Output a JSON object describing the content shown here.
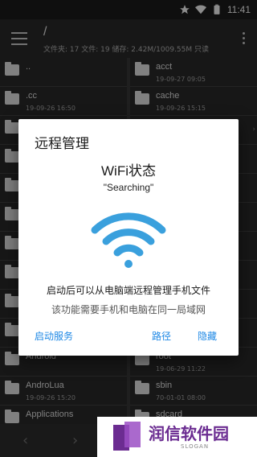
{
  "status_bar": {
    "time": "11:41",
    "icons": [
      "star-icon",
      "wifi-icon",
      "battery-icon"
    ]
  },
  "toolbar": {
    "path": "/",
    "stats": "文件夹: 17  文件: 19  储存: 2.42M/1009.55M  只读"
  },
  "files_left": [
    {
      "name": "..",
      "date": ""
    },
    {
      "name": ".cc",
      "date": "19-09-26 16:50"
    },
    {
      "name": "",
      "date": ""
    },
    {
      "name": "",
      "date": ""
    },
    {
      "name": "",
      "date": ""
    },
    {
      "name": "",
      "date": ""
    },
    {
      "name": "",
      "date": ""
    },
    {
      "name": "",
      "date": ""
    },
    {
      "name": "",
      "date": ""
    },
    {
      "name": "",
      "date": ""
    },
    {
      "name": "Android",
      "date": ""
    },
    {
      "name": "AndroLua",
      "date": "19-09-26 15:20"
    },
    {
      "name": "Applications",
      "date": ""
    }
  ],
  "files_right": [
    {
      "name": "acct",
      "date": "19-09-27 09:05"
    },
    {
      "name": "cache",
      "date": "19-09-26 15:15"
    },
    {
      "name": "",
      "date": ""
    },
    {
      "name": "",
      "date": ""
    },
    {
      "name": "",
      "date": ""
    },
    {
      "name": "",
      "date": ""
    },
    {
      "name": "",
      "date": ""
    },
    {
      "name": "",
      "date": ""
    },
    {
      "name": "",
      "date": ""
    },
    {
      "name": "",
      "date": ""
    },
    {
      "name": "root",
      "date": "19-06-29 11:22"
    },
    {
      "name": "sbin",
      "date": "70-01-01 08:00"
    },
    {
      "name": "sdcard",
      "date": ""
    }
  ],
  "dialog": {
    "title": "远程管理",
    "wifi_status": "WiFi状态",
    "searching": "\"Searching\"",
    "message_1": "启动后可以从电脑端远程管理手机文件",
    "message_2": "该功能需要手机和电脑在同一局域网",
    "btn_start": "启动服务",
    "btn_path": "路径",
    "btn_hide": "隐藏",
    "accent_color": "#1e88e5",
    "wifi_color": "#3aa0dd"
  },
  "watermark": {
    "text": "润信软件园",
    "slogan": "SLOGAN",
    "color": "#6b2c91"
  }
}
